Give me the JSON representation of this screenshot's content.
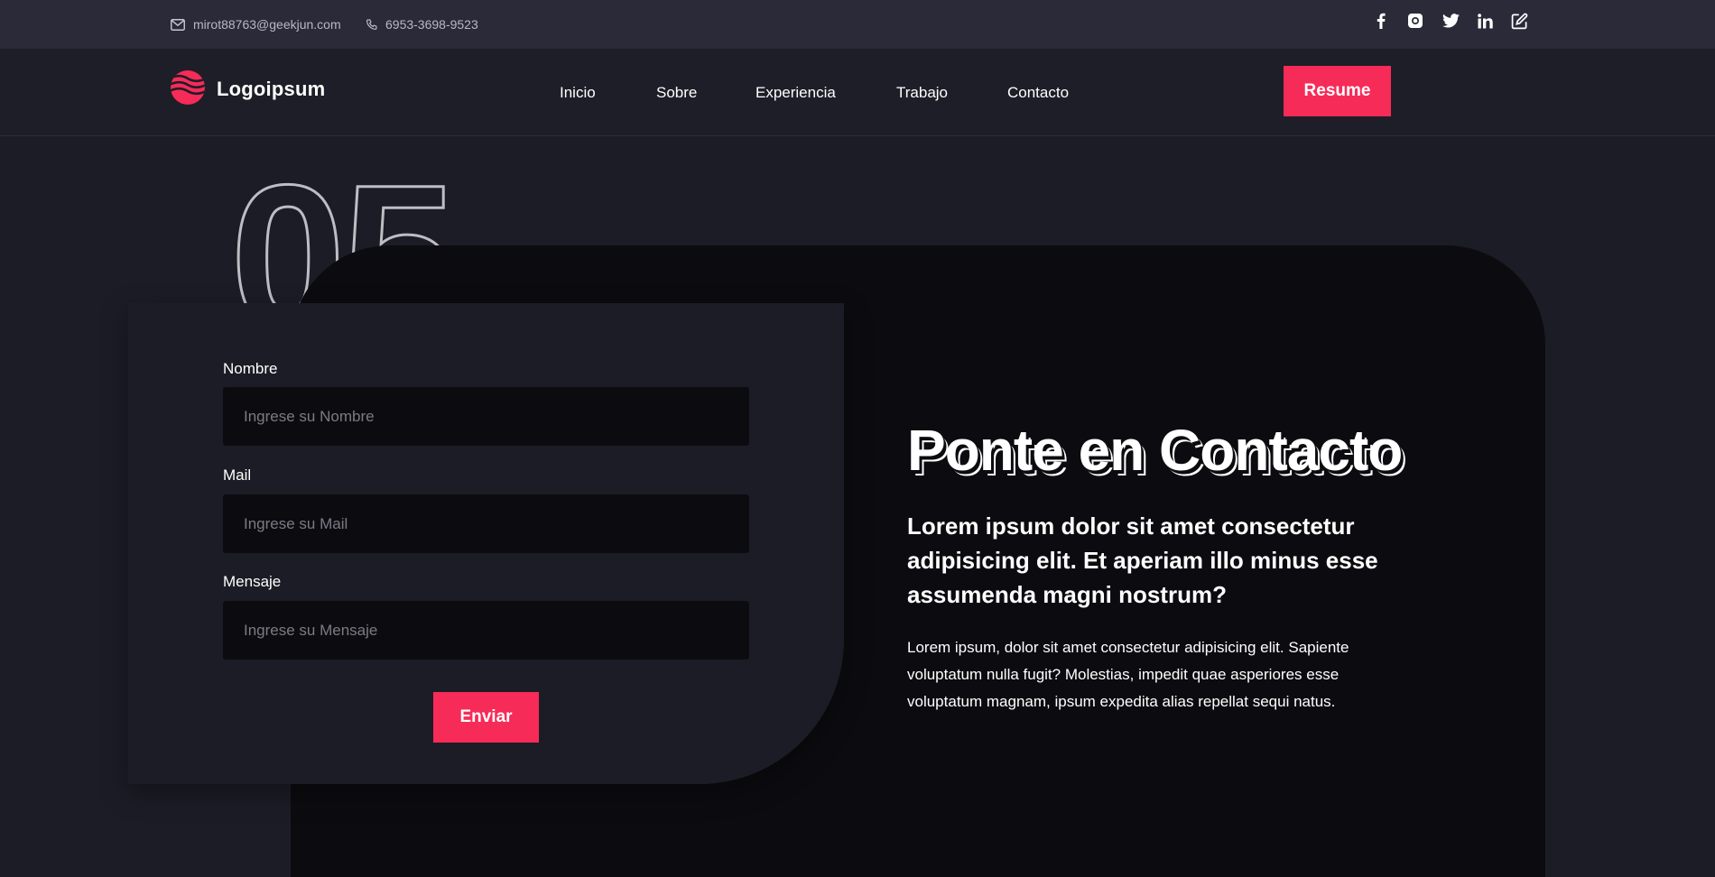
{
  "topbar": {
    "email": "mirot88763@geekjun.com",
    "phone": "6953-3698-9523",
    "social": [
      "facebook-icon",
      "instagram-icon",
      "twitter-icon",
      "linkedin-icon",
      "edit-icon"
    ]
  },
  "brand": {
    "name": "Logoipsum"
  },
  "nav": {
    "items": [
      {
        "label": "Inicio"
      },
      {
        "label": "Sobre"
      },
      {
        "label": "Experiencia"
      },
      {
        "label": "Trabajo"
      },
      {
        "label": "Contacto"
      }
    ],
    "resume_label": "Resume"
  },
  "section": {
    "number": "05"
  },
  "form": {
    "fields": [
      {
        "label": "Nombre",
        "placeholder": "Ingrese su Nombre"
      },
      {
        "label": "Mail",
        "placeholder": "Ingrese su Mail"
      },
      {
        "label": "Mensaje",
        "placeholder": "Ingrese su Mensaje"
      }
    ],
    "submit_label": "Enviar"
  },
  "contact": {
    "title": "Ponte en Contacto",
    "subtitle": "Lorem ipsum dolor sit amet consectetur adipisicing elit. Et aperiam illo minus esse assumenda magni nostrum?",
    "body": "Lorem ipsum, dolor sit amet consectetur adipisicing elit. Sapiente voluptatum nulla fugit? Molestias, impedit quae asperiores esse voluptatum magnam, ipsum expedita alias repellat sequi natus."
  },
  "colors": {
    "accent": "#f72b58",
    "background": "#1c1c26",
    "panel": "#0c0c10",
    "topbar": "#2a2a38"
  }
}
